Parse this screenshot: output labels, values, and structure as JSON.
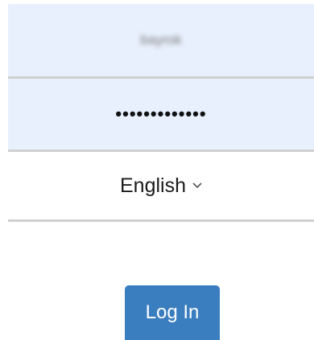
{
  "login": {
    "username_value": "bayrok",
    "password_value": "•••••••••••••",
    "language_selected": "English",
    "login_button_label": "Log In"
  },
  "icons": {
    "language_dropdown": "chevron-down-icon"
  },
  "colors": {
    "field_background": "#e8f0fd",
    "divider": "#d0d0d0",
    "button_background": "#3a7ebf",
    "button_text": "#ffffff"
  }
}
